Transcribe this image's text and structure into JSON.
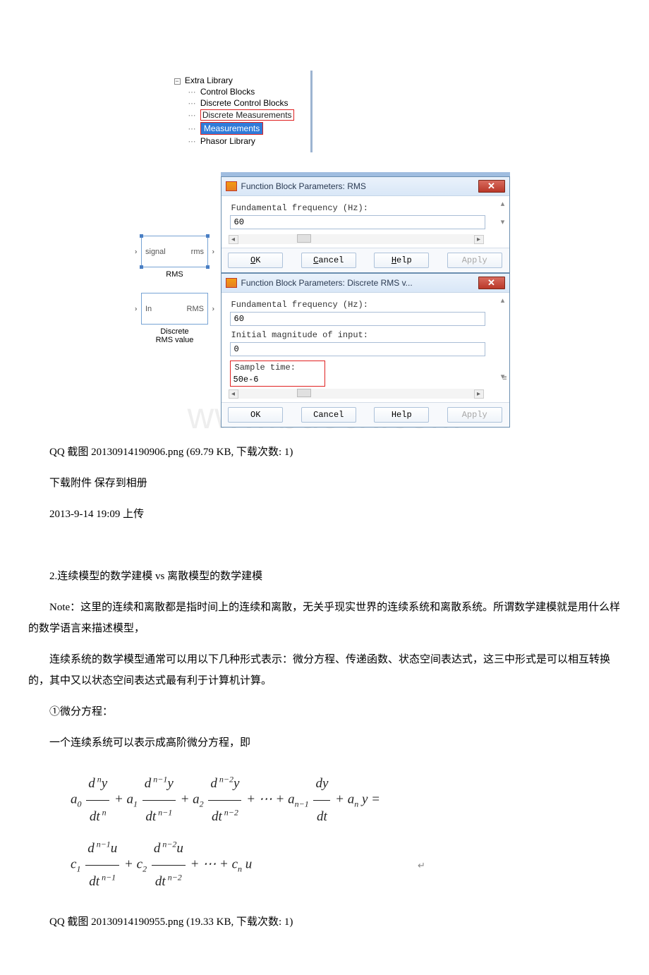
{
  "tree": {
    "root": "Extra Library",
    "toggle": "−",
    "children": [
      "Control  Blocks",
      "Discrete  Control Blocks",
      "Discrete Measurements",
      "Measurements",
      "Phasor Library"
    ]
  },
  "sim_blocks": {
    "block1": {
      "port_in": "signal",
      "port_out": "rms",
      "title": "RMS"
    },
    "block2": {
      "port_in": "In",
      "port_out": "RMS",
      "title": "Discrete\nRMS value"
    }
  },
  "dialog1": {
    "title": "Function Block Parameters: RMS",
    "close": "✕",
    "label1": "Fundamental frequency (Hz):",
    "value1": "60",
    "btn_ok": "OK",
    "btn_cancel": "Cancel",
    "btn_help": "Help",
    "btn_apply": "Apply"
  },
  "dialog2": {
    "title": "Function Block Parameters: Discrete RMS v...",
    "close": "✕",
    "label1": "Fundamental frequency (Hz):",
    "value1": "60",
    "label2": "Initial magnitude of input:",
    "value2": "0",
    "label3": "Sample time:",
    "value3": "50e-6",
    "btn_ok": "OK",
    "btn_cancel": "Cancel",
    "btn_help": "Help",
    "btn_apply": "Apply",
    "eq_mark": "≡"
  },
  "watermark": "www.bdocx.com",
  "text": {
    "p1": "QQ 截图 20130914190906.png (69.79 KB, 下载次数: 1)",
    "p2": "下载附件  保存到相册",
    "p3": "2013-9-14 19:09 上传",
    "p4": "2.连续模型的数学建模 vs 离散模型的数学建模",
    "p5": "Note：这里的连续和离散都是指时间上的连续和离散，无关乎现实世界的连续系统和离散系统。所谓数学建模就是用什么样的数学语言来描述模型，",
    "p6": "　　连续系统的数学模型通常可以用以下几种形式表示：微分方程、传递函数、状态空间表达式，这三中形式是可以相互转换的，其中又以状态空间表达式最有利于计算机计算。",
    "p7": "　　①微分方程：",
    "p8": "一个连续系统可以表示成高阶微分方程，即",
    "p9": "QQ 截图 20130914190955.png (19.33 KB, 下载次数: 1)"
  },
  "enter_sym": "↵"
}
